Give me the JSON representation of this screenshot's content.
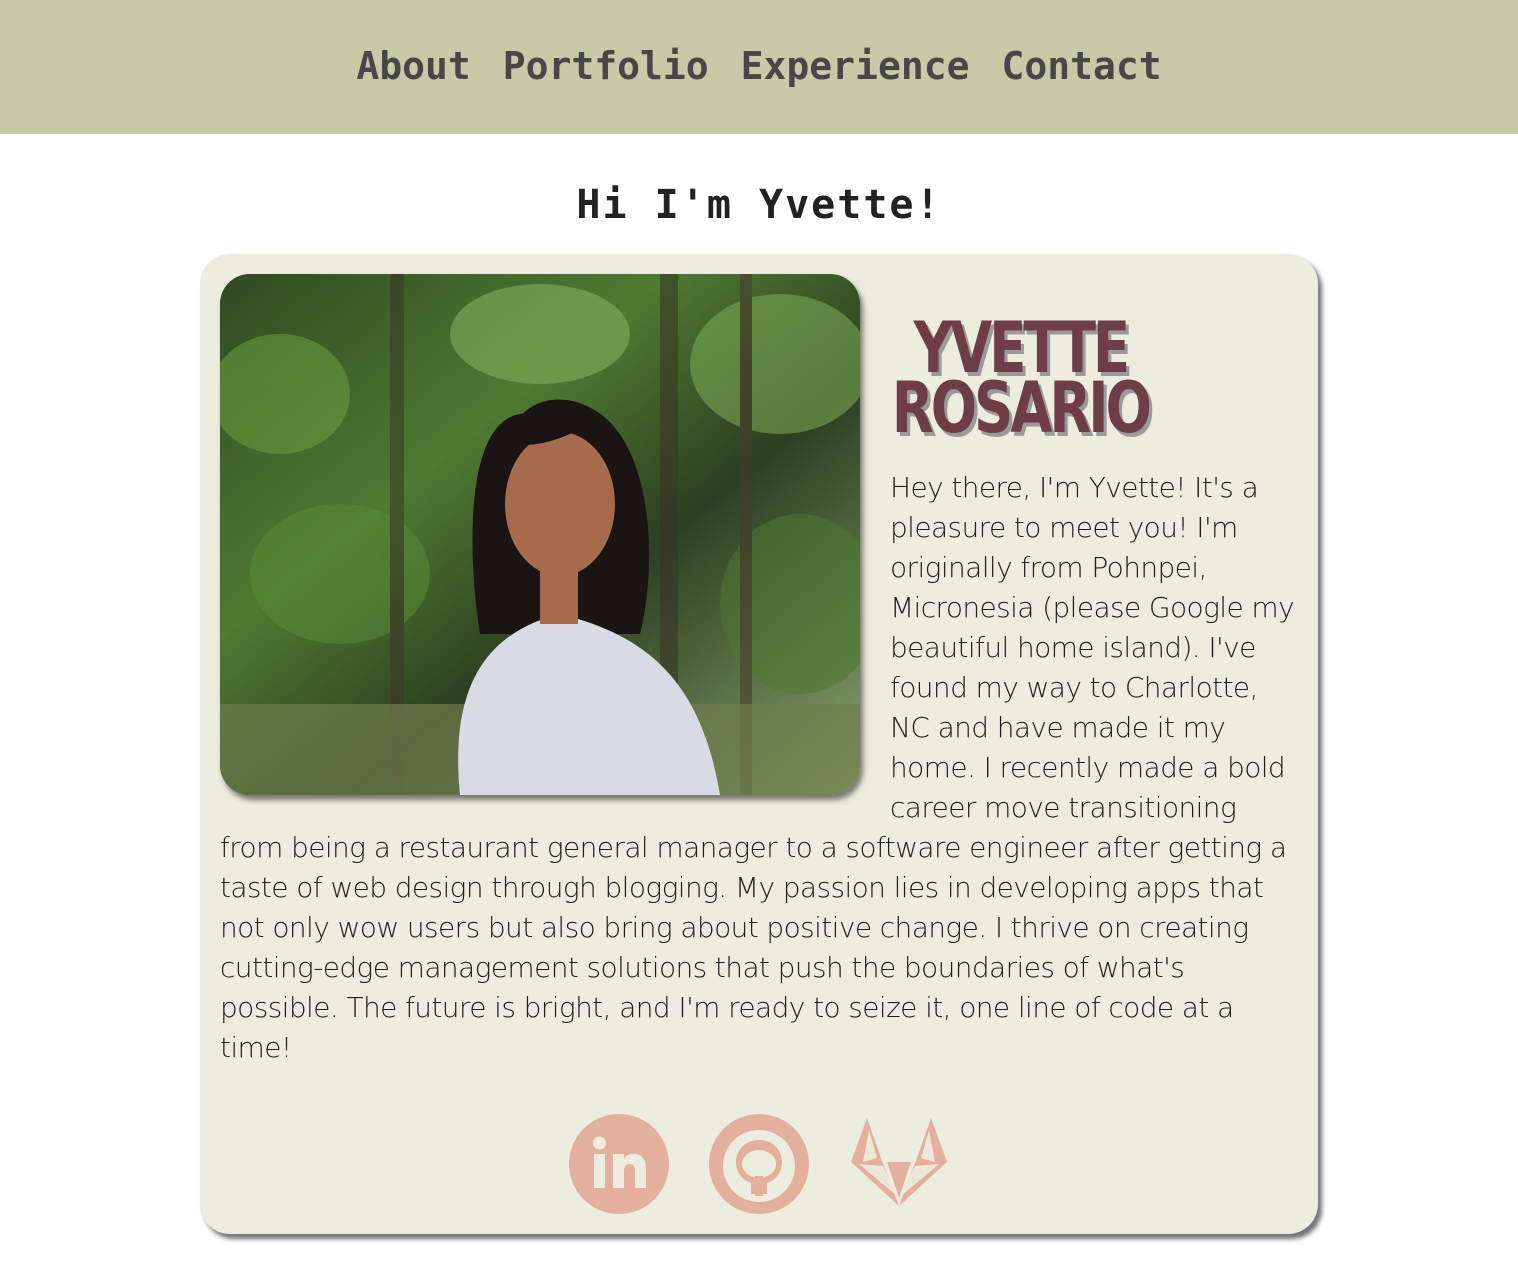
{
  "nav": {
    "items": [
      {
        "label": "About"
      },
      {
        "label": "Portfolio"
      },
      {
        "label": "Experience"
      },
      {
        "label": "Contact"
      }
    ],
    "background": "#c8c9a6"
  },
  "hero": {
    "heading": "Hi I'm Yvette!"
  },
  "profile": {
    "first_name": "Yvette",
    "last_name": "Rosario",
    "name_color": "#6e3d45",
    "photo_alt": "Portrait photo",
    "bio": "Hey there, I'm Yvette! It's a pleasure to meet you! I'm originally from Pohnpei, Micronesia (please Google my beautiful home island). I've found my way to Charlotte, NC and have made it my home. I recently made a bold career move transitioning from being a restaurant general manager to a software engineer after getting a taste of web design through blogging. My passion lies in developing apps that not only wow users but also bring about positive change. I thrive on creating cutting-edge management solutions that push the boundaries of what's possible. The future is bright, and I'm ready to seize it, one line of code at a time!",
    "card_background": "#ededdf"
  },
  "socials": {
    "color": "#e4b09e",
    "items": [
      {
        "icon": "linkedin-icon"
      },
      {
        "icon": "github-icon"
      },
      {
        "icon": "gitlab-icon"
      }
    ]
  }
}
